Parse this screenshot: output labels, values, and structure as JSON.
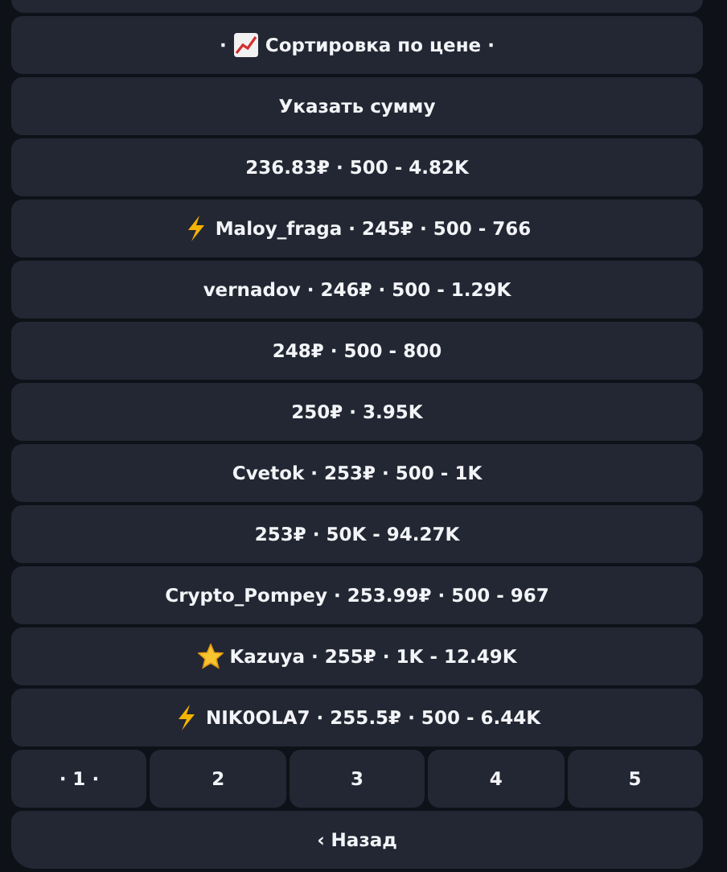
{
  "buttons": [
    {
      "kind": "chart",
      "prefix": "·",
      "label": "Сортировка по цене ·"
    },
    {
      "kind": "plain",
      "label": "Указать сумму"
    },
    {
      "kind": "plain",
      "label": "236.83₽ · 500 - 4.82K"
    },
    {
      "kind": "lightning",
      "label": "Maloy_fraga · 245₽ · 500 - 766"
    },
    {
      "kind": "plain",
      "label": "vernadov · 246₽ · 500 - 1.29K"
    },
    {
      "kind": "plain",
      "label": "248₽ · 500 - 800"
    },
    {
      "kind": "plain",
      "label": "250₽ · 3.95K"
    },
    {
      "kind": "plain",
      "label": "Cvetok · 253₽ · 500 - 1K"
    },
    {
      "kind": "plain",
      "label": "253₽ · 50K - 94.27K"
    },
    {
      "kind": "plain",
      "label": "Crypto_Pompey · 253.99₽ · 500 - 967"
    },
    {
      "kind": "star",
      "label": "Kazuya · 255₽ · 1K - 12.49K"
    },
    {
      "kind": "lightning",
      "label": "NIK0OLA7 · 255.5₽ · 500 - 6.44K"
    }
  ],
  "pages": [
    "· 1 ·",
    "2",
    "3",
    "4",
    "5"
  ],
  "back": "‹ Назад"
}
